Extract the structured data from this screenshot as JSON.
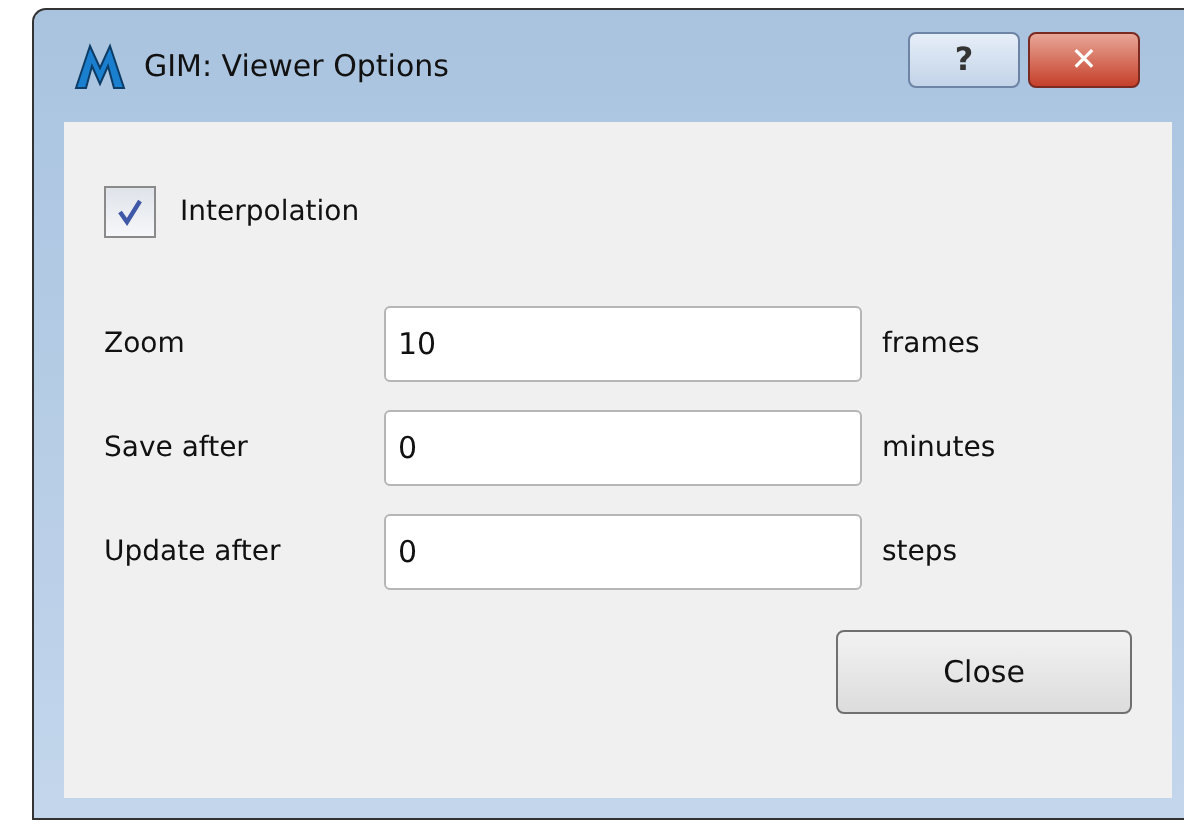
{
  "window": {
    "title": "GIM: Viewer Options"
  },
  "title_buttons": [
    {
      "kind": "help",
      "label": "?"
    },
    {
      "kind": "close",
      "label": "✕"
    }
  ],
  "interpolation": {
    "label": "Interpolation",
    "checked": true
  },
  "fields": [
    {
      "label": "Zoom",
      "value": "10",
      "unit": "frames"
    },
    {
      "label": "Save after",
      "value": "0",
      "unit": "minutes"
    },
    {
      "label": "Update after",
      "value": "0",
      "unit": "steps"
    }
  ],
  "buttons": [
    "Close"
  ]
}
